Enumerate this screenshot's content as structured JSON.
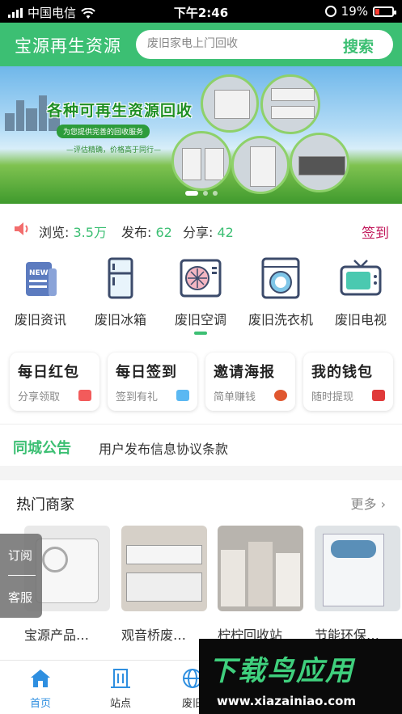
{
  "status_bar": {
    "carrier": "中国电信",
    "time": "下午2:46",
    "battery": "19%"
  },
  "header": {
    "title": "宝源再生资源",
    "search_placeholder": "废旧家电上门回收",
    "search_button": "搜索"
  },
  "banner": {
    "title": "各种可再生资源回收",
    "subtitle": "为您提供完善的回收服务",
    "tagline": "—评估精确，价格高于同行—",
    "slide_count": 3,
    "active_slide": 1
  },
  "stats": {
    "views_label": "浏览:",
    "views_value": "3.5万",
    "posts_label": "发布:",
    "posts_value": "62",
    "shares_label": "分享:",
    "shares_value": "42",
    "signin": "签到"
  },
  "categories": [
    {
      "label": "废旧资讯",
      "icon": "newspaper-icon"
    },
    {
      "label": "废旧冰箱",
      "icon": "fridge-icon"
    },
    {
      "label": "废旧空调",
      "icon": "air-conditioner-icon"
    },
    {
      "label": "废旧洗衣机",
      "icon": "washing-machine-icon"
    },
    {
      "label": "废旧电视",
      "icon": "tv-icon"
    }
  ],
  "cards": [
    {
      "title": "每日红包",
      "subtitle": "分享领取",
      "icon": "red-envelope-icon",
      "color": "#f25b5b"
    },
    {
      "title": "每日签到",
      "subtitle": "签到有礼",
      "icon": "gift-icon",
      "color": "#5bb8f2"
    },
    {
      "title": "邀请海报",
      "subtitle": "简单赚钱",
      "icon": "money-bag-icon",
      "color": "#e0572f"
    },
    {
      "title": "我的钱包",
      "subtitle": "随时提现",
      "icon": "wallet-icon",
      "color": "#e03a3a"
    }
  ],
  "notice": {
    "tag": "同城公告",
    "text": "用户发布信息协议条款"
  },
  "merchants": {
    "title": "热门商家",
    "more": "更多",
    "items": [
      {
        "name": "宝源产品…"
      },
      {
        "name": "观音桥废…"
      },
      {
        "name": "柠柠回收站"
      },
      {
        "name": "节能环保…"
      }
    ]
  },
  "float_menu": {
    "subscribe": "订阅",
    "service": "客服"
  },
  "bottom_nav": [
    {
      "label": "首页",
      "icon": "home-icon"
    },
    {
      "label": "站点",
      "icon": "building-icon"
    },
    {
      "label": "废旧",
      "icon": "globe-icon"
    }
  ],
  "watermark": {
    "brand": "下载鸟应用",
    "url": "www.xiazainiao.com"
  },
  "colors": {
    "brand_green": "#3cbf73",
    "active_nav": "#2f8fe0",
    "signin": "#c2185b"
  }
}
